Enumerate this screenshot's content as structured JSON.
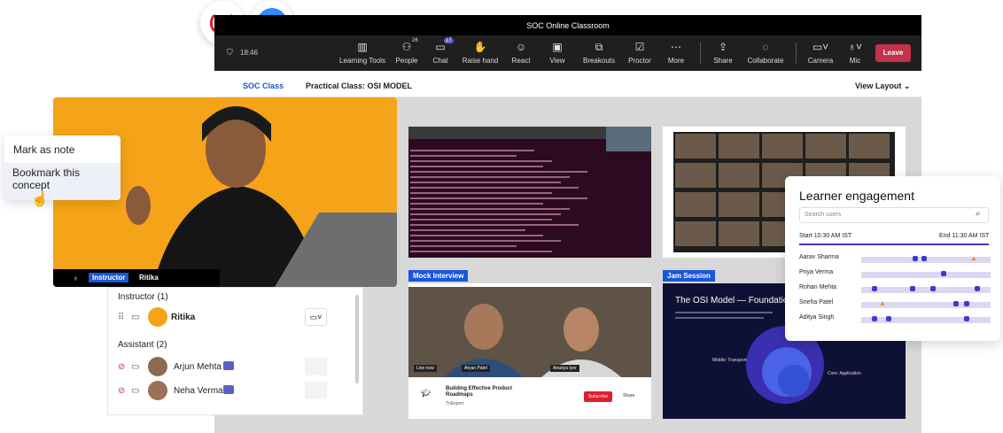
{
  "window": {
    "title": "SOC Online Classroom",
    "time": "18:46"
  },
  "toolbar": {
    "items": [
      {
        "label": "Learning Tools"
      },
      {
        "label": "People",
        "badge": "26"
      },
      {
        "label": "Chat",
        "badge": "17"
      },
      {
        "label": "Raise hand"
      },
      {
        "label": "React"
      },
      {
        "label": "View"
      },
      {
        "label": "Breakouts"
      },
      {
        "label": "Proctor"
      },
      {
        "label": "More"
      },
      {
        "label": "Share"
      },
      {
        "label": "Collaborate"
      },
      {
        "label": "Camera"
      },
      {
        "label": "Mic"
      }
    ],
    "leave_label": "Leave"
  },
  "subheader": {
    "tab": "SOC Class",
    "title": "Practical Class: OSI MODEL",
    "view_layout": "View Layout"
  },
  "context_menu": {
    "item1": "Mark as note",
    "item2": "Bookmark this concept"
  },
  "video": {
    "role": "Instructor",
    "name": "Ritika"
  },
  "people": {
    "instructor_header": "Instructor (1)",
    "instructor_name": "Ritika",
    "assistant_header": "Assistant (2)",
    "assistants": [
      "Arjun Mehta",
      "Neha Verma"
    ]
  },
  "tiles": {
    "mock_interview": "Mock Interview",
    "jam_session": "Jam Session",
    "card_title": "Building Effective Product Roadmaps",
    "card_host": "TnExpert",
    "subscribe": "Subscribe",
    "share": "Share",
    "live_now": "Live now",
    "speaker1": "Aryan Patel",
    "speaker2": "Ananya Iyer",
    "slide_title": "The OSI Model — Foundation of",
    "slide_label1": "Middle: Transport",
    "slide_label2": "Core: Application"
  },
  "engagement": {
    "title": "Learner engagement",
    "search_placeholder": "Search users",
    "start": "Start 10:30 AM IST",
    "end": "End 11:30 AM IST",
    "learners": [
      "Aarav Sharma",
      "Priya Verma",
      "Rohan Mehta",
      "Sneha Patel",
      "Aditya Singh"
    ]
  },
  "colors": {
    "accent": "#1a56db",
    "leave": "#c4314b",
    "video_bg": "#f5a318",
    "record": "#e11d2e",
    "zoom": "#2d8cff"
  }
}
